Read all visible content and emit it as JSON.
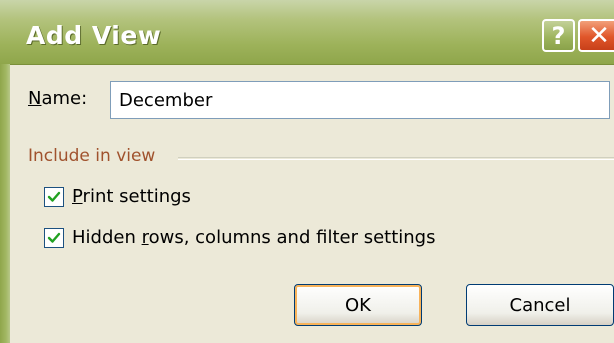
{
  "dialog": {
    "title": "Add View",
    "help_glyph": "?",
    "close_glyph": "✕",
    "colors": {
      "title_bar": "#9db25a",
      "close": "#e0562a",
      "group_label": "#a0522d"
    }
  },
  "name_field": {
    "label_underlined": "N",
    "label_rest": "ame:",
    "value": "December"
  },
  "include_group": {
    "label": "Include in view",
    "options": [
      {
        "underlined": "P",
        "rest": "rint settings",
        "checked": true
      },
      {
        "prefix": "Hidden ",
        "underlined": "r",
        "rest": "ows, columns and filter settings",
        "checked": true
      }
    ]
  },
  "buttons": {
    "ok": "OK",
    "cancel": "Cancel"
  }
}
